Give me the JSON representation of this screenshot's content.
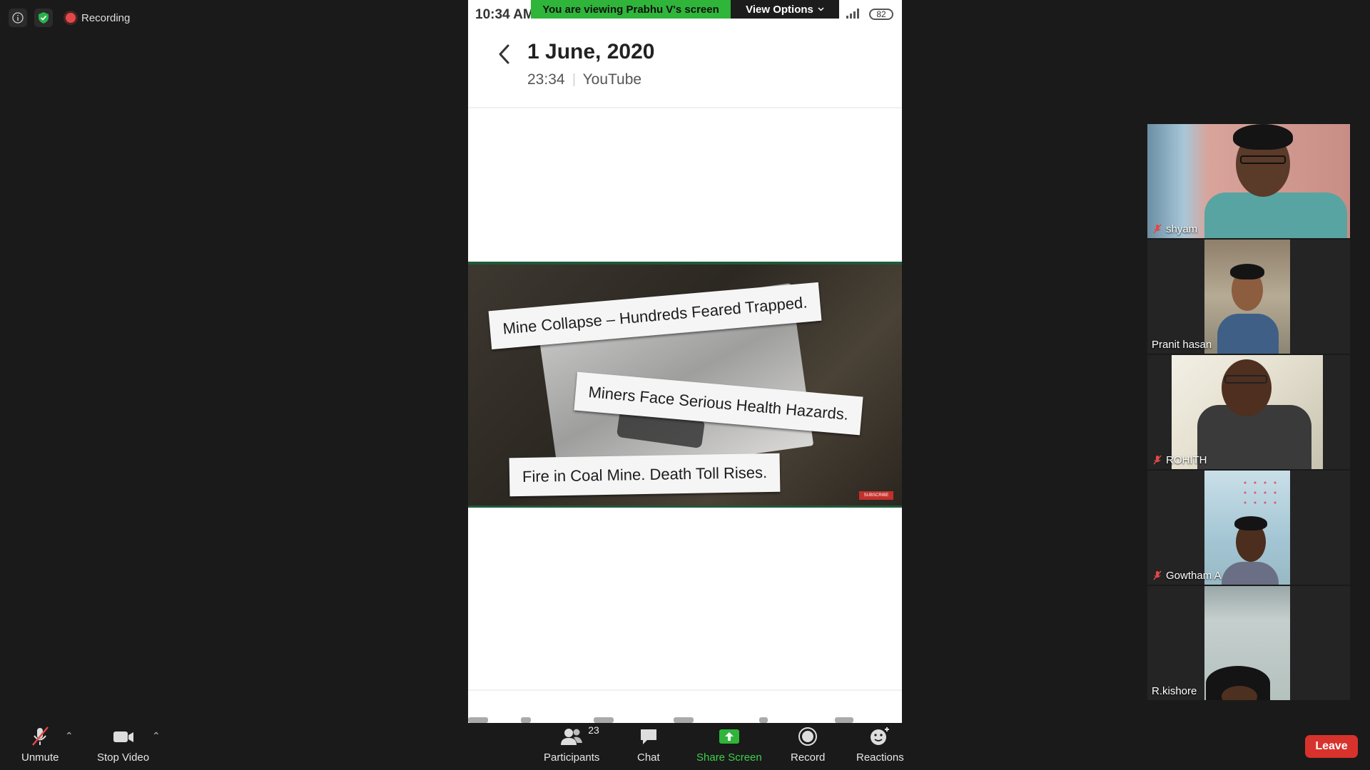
{
  "meeting": {
    "recording_label": "Recording",
    "colors": {
      "recording": "#e34848",
      "secure": "#27b34b",
      "share_green": "#2fb53a",
      "leave": "#d8322c"
    },
    "icons": [
      "info-icon",
      "shield-check-icon",
      "recording-icon"
    ]
  },
  "share": {
    "phone_time": "10:34 AM",
    "viewing_banner": "You are viewing Prabhu V's screen",
    "view_options": "View Options",
    "battery": "82",
    "post": {
      "date": "1 June, 2020",
      "time": "23:34",
      "source": "YouTube"
    },
    "video": {
      "headlines": [
        "Mine Collapse – Hundreds Feared Trapped.",
        "Miners Face Serious Health Hazards.",
        "Fire in Coal Mine. Death Toll Rises."
      ],
      "subscribe": "SUBSCRIBE"
    }
  },
  "participants": [
    {
      "name": "shyam",
      "muted": true
    },
    {
      "name": "Pranit hasan",
      "muted": false
    },
    {
      "name": "ROHITH",
      "muted": true
    },
    {
      "name": "Gowtham A",
      "muted": true
    },
    {
      "name": "R.kishore",
      "muted": false
    }
  ],
  "toolbar": {
    "unmute": "Unmute",
    "stop_video": "Stop Video",
    "participants": "Participants",
    "participants_count": "23",
    "chat": "Chat",
    "share_screen": "Share Screen",
    "record": "Record",
    "reactions": "Reactions",
    "leave": "Leave"
  }
}
